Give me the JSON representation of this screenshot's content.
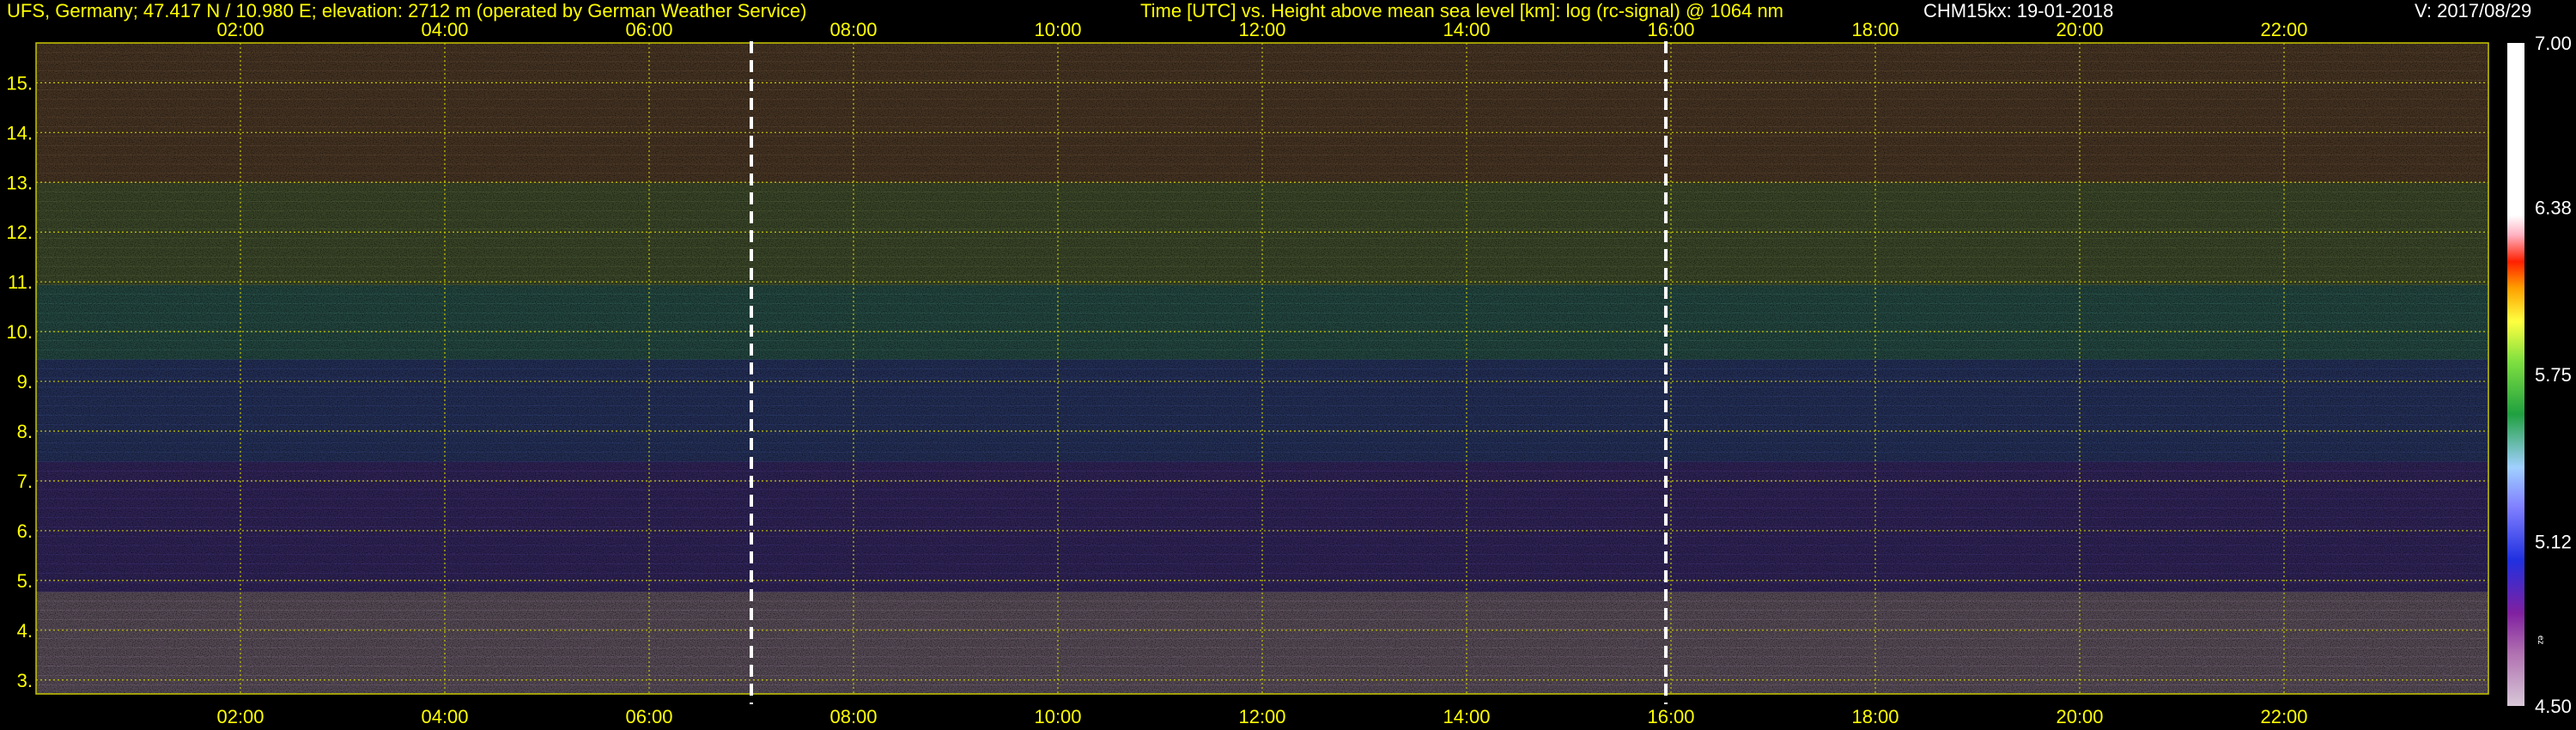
{
  "header": {
    "station": "UFS, Germany; 47.417 N / 10.980 E; elevation: 2712 m  (operated by German Weather Service)",
    "title": "Time [UTC] vs. Height above mean sea level [km]: log (rc-signal) @ 1064 nm",
    "instrument_date": "CHM15kx: 19-01-2018",
    "version": "V: 2017/08/29"
  },
  "colorbar": {
    "labels": [
      "7.00",
      "6.38",
      "5.75",
      "5.12",
      "4.50"
    ],
    "small_label": "ez"
  },
  "colors": {
    "text": "#ffff00",
    "grid": "#c8c800",
    "marker": "#ffffff",
    "background": "#000000"
  },
  "chart_data": {
    "type": "heatmap",
    "title": "Time [UTC] vs. Height above mean sea level [km]: log (rc-signal) @ 1064 nm",
    "xlabel": "",
    "ylabel": "",
    "x_ticks": [
      "02:00",
      "04:00",
      "06:00",
      "08:00",
      "10:00",
      "12:00",
      "14:00",
      "16:00",
      "18:00",
      "20:00",
      "22:00"
    ],
    "x_range_hours": [
      0,
      24
    ],
    "y_ticks": [
      "3.",
      "4.",
      "5.",
      "6.",
      "7.",
      "8.",
      "9.",
      "10.",
      "11.",
      "12.",
      "13.",
      "14.",
      "15."
    ],
    "y_range_km": [
      2.72,
      15.8
    ],
    "grid": true,
    "color_scale": {
      "min": 4.5,
      "max": 7.0,
      "ticks": [
        7.0,
        6.38,
        5.75,
        5.12,
        4.5
      ]
    },
    "marker_times_hours": [
      7.0,
      15.95
    ],
    "signal_profile": [
      {
        "height_km": 3.0,
        "value": 4.9
      },
      {
        "height_km": 4.5,
        "value": 5.0
      },
      {
        "height_km": 6.0,
        "value": 5.15
      },
      {
        "height_km": 7.5,
        "value": 5.3
      },
      {
        "height_km": 9.0,
        "value": 5.5
      },
      {
        "height_km": 10.5,
        "value": 5.7
      },
      {
        "height_km": 12.0,
        "value": 5.9
      },
      {
        "height_km": 13.5,
        "value": 6.05
      },
      {
        "height_km": 15.5,
        "value": 6.2
      }
    ]
  }
}
